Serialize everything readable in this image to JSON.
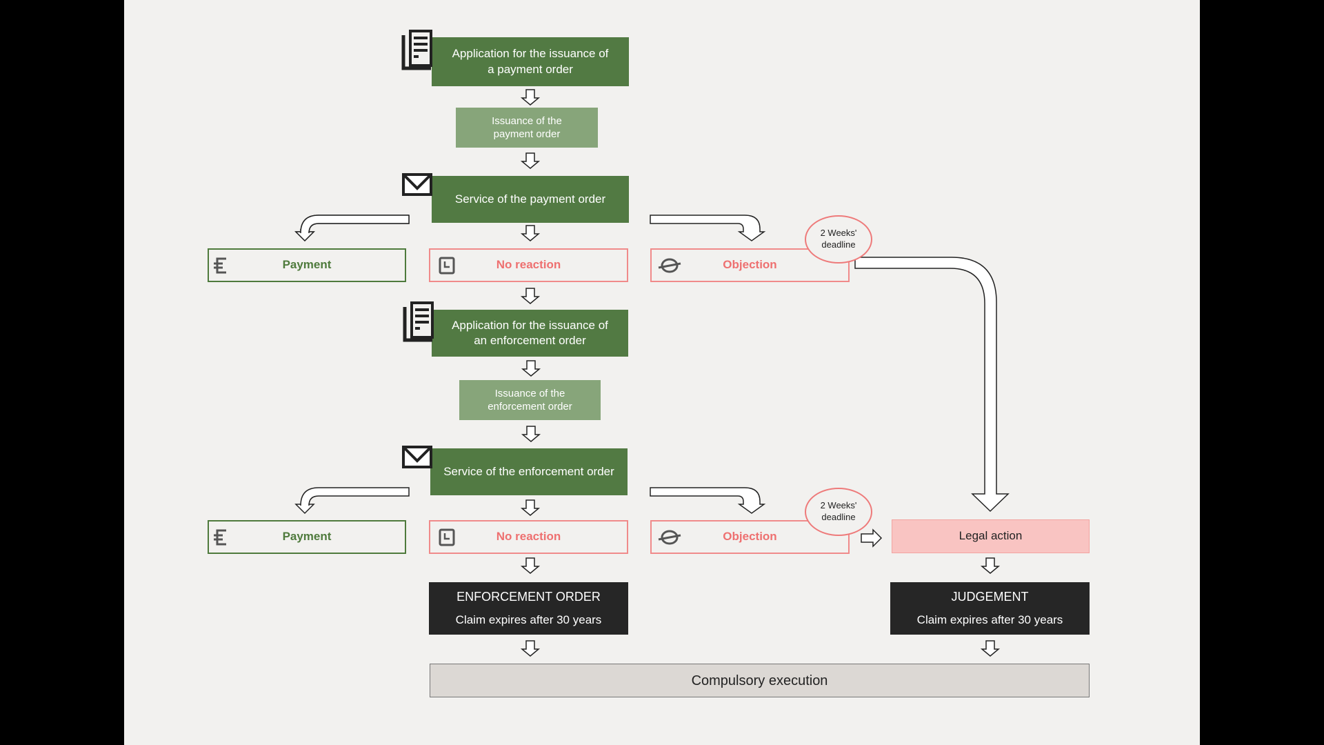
{
  "steps": {
    "application_payment": "Application for the issuance of a payment order",
    "issuance_payment": "Issuance of the payment order",
    "service_payment": "Service of the payment order",
    "application_enforcement": "Application for the issuance of an enforcement order",
    "issuance_enforcement": "Issuance of the enforcement order",
    "service_enforcement": "Service of the enforcement order"
  },
  "outcomes": {
    "payment": "Payment",
    "no_reaction": "No reaction",
    "objection": "Objection",
    "deadline": "2 Weeks' deadline",
    "legal_action": "Legal action"
  },
  "results": {
    "enforcement_title": "ENFORCEMENT ORDER",
    "enforcement_sub": "Claim expires after 30 years",
    "judgement_title": "JUDGEMENT",
    "judgement_sub": "Claim expires after 30 years",
    "compulsory": "Compulsory execution"
  },
  "colors": {
    "dark_green": "#527a43",
    "light_green": "#87a57a",
    "red": "#ee7070",
    "legal_fill": "#f9c4c2",
    "black": "#262626",
    "gray": "#dcd8d4"
  }
}
